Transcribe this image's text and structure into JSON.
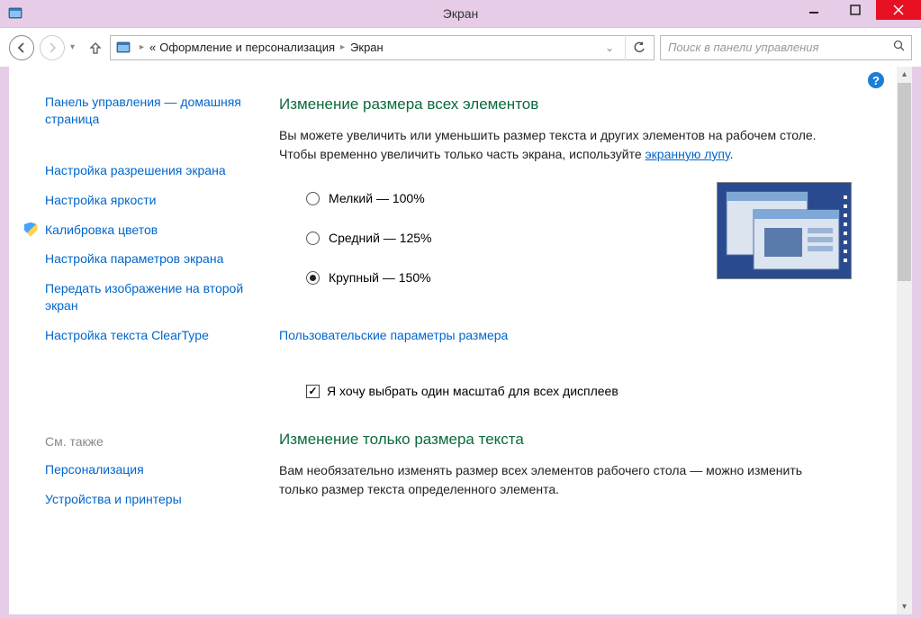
{
  "titlebar": {
    "title": "Экран"
  },
  "nav": {
    "breadcrumb_prefix": "«",
    "breadcrumb1": "Оформление и персонализация",
    "breadcrumb2": "Экран",
    "search_placeholder": "Поиск в панели управления"
  },
  "sidebar": {
    "home": "Панель управления — домашняя страница",
    "items": [
      "Настройка разрешения экрана",
      "Настройка яркости",
      "Калибровка цветов",
      "Настройка параметров экрана",
      "Передать изображение на второй экран",
      "Настройка текста ClearType"
    ],
    "see_also_heading": "См. также",
    "see_also": [
      "Персонализация",
      "Устройства и принтеры"
    ]
  },
  "main": {
    "heading1": "Изменение размера всех элементов",
    "para1a": "Вы можете увеличить или уменьшить размер текста и других элементов на рабочем столе. Чтобы временно увеличить только часть экрана, используйте ",
    "magnifier_link": "экранную лупу",
    "period": ".",
    "radios": [
      {
        "label": "Мелкий — 100%",
        "checked": false
      },
      {
        "label": "Средний — 125%",
        "checked": false
      },
      {
        "label": "Крупный — 150%",
        "checked": true
      }
    ],
    "custom_link": "Пользовательские параметры размера",
    "checkbox_label": "Я хочу выбрать один масштаб для всех дисплеев",
    "checkbox_checked": true,
    "heading2": "Изменение только размера текста",
    "para2": "Вам необязательно изменять размер всех элементов рабочего стола — можно изменить только размер текста определенного элемента."
  }
}
